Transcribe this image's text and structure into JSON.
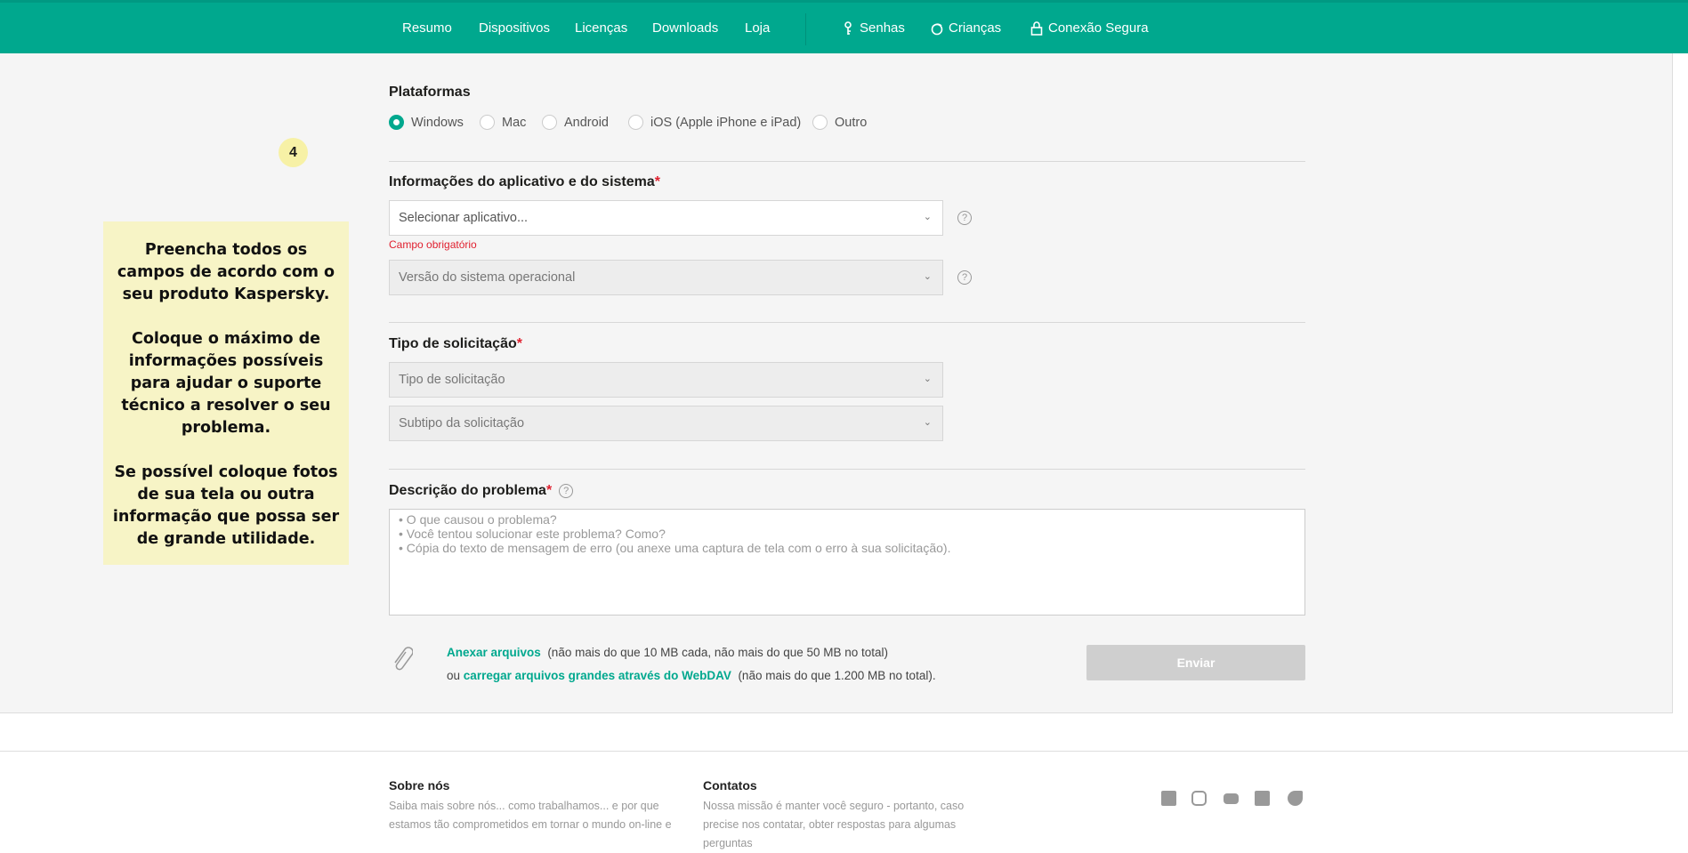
{
  "nav": {
    "items": [
      "Resumo",
      "Dispositivos",
      "Licenças",
      "Downloads",
      "Loja"
    ],
    "extras": [
      "Senhas",
      "Crianças",
      "Conexão Segura"
    ]
  },
  "badge": "4",
  "note": [
    "Preencha todos os campos de acordo com o seu produto Kaspersky.",
    "Coloque o máximo de informações possíveis para ajudar o suporte técnico a resolver o seu problema.",
    "Se possível coloque fotos de sua tela ou outra informação que possa ser de grande utilidade."
  ],
  "platforms": {
    "title": "Plataformas",
    "options": [
      "Windows",
      "Mac",
      "Android",
      "iOS (Apple iPhone e iPad)",
      "Outro"
    ],
    "selected": "Windows"
  },
  "app_info": {
    "title": "Informações do aplicativo e do sistema",
    "required": "*",
    "app_select": "Selecionar aplicativo...",
    "error": "Campo obrigatório",
    "os_select": "Versão do sistema operacional",
    "help": "?"
  },
  "request": {
    "title": "Tipo de solicitação",
    "required": "*",
    "type_select": "Tipo de solicitação",
    "subtype_select": "Subtipo da solicitação"
  },
  "description": {
    "title": "Descrição do problema",
    "required": "*",
    "help": "?",
    "placeholder_lines": [
      "• O que causou o problema?",
      "• Você tentou solucionar este problema? Como?",
      "• Cópia do texto de mensagem de erro (ou anexe uma captura de tela com o erro à sua solicitação)."
    ]
  },
  "attach": {
    "link": "Anexar arquivos",
    "limit": "(não mais do que 10 MB cada, não mais do que 50 MB no total)",
    "or": "ou",
    "webdav_link": "carregar arquivos grandes através do WebDAV",
    "webdav_limit": "(não mais do que 1.200 MB no total)."
  },
  "submit": "Enviar",
  "footer": {
    "about_title": "Sobre nós",
    "about_text": "Saiba mais sobre nós... como trabalhamos... e por que estamos tão comprometidos em tornar o mundo on-line e",
    "contacts_title": "Contatos",
    "contacts_text": "Nossa missão é manter você seguro - portanto, caso precise nos contatar, obter respostas para algumas perguntas"
  },
  "colors": {
    "brand": "#00a88e",
    "note": "#f7f4c6",
    "required": "#e0202f"
  }
}
